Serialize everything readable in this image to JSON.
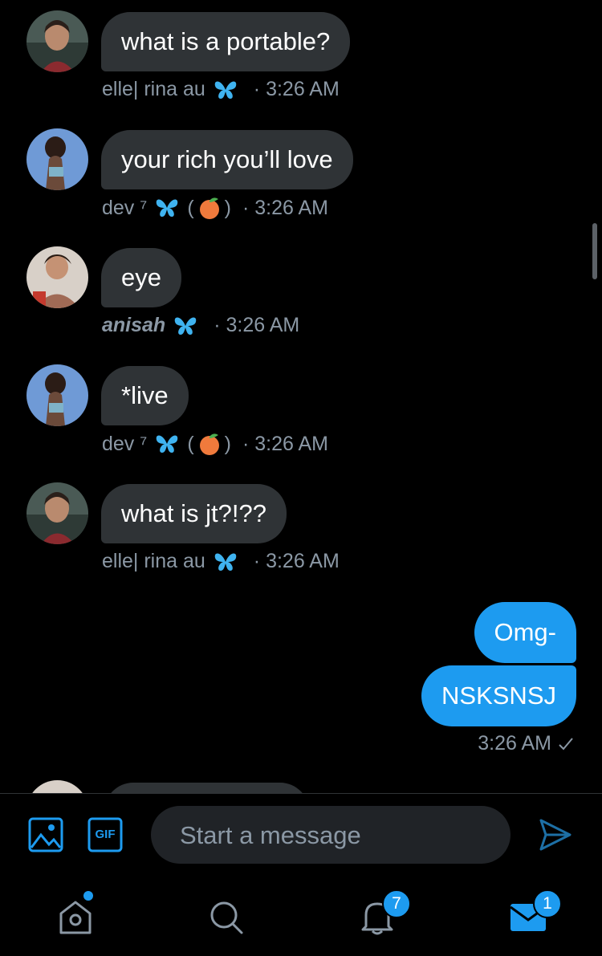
{
  "messages": [
    {
      "text": "what is a portable?",
      "author": "elle| rina au",
      "time": "· 3:26 AM"
    },
    {
      "text": "your rich you’ll love",
      "author": "dev ⁷",
      "time": "· 3:26 AM"
    },
    {
      "text": "eye",
      "author": "anisah",
      "time": "· 3:26 AM"
    },
    {
      "text": "*live",
      "author": "dev ⁷",
      "time": "· 3:26 AM"
    },
    {
      "text": "what is jt?!??",
      "author": "elle| rina au",
      "time": "· 3:26 AM"
    }
  ],
  "outgoing": {
    "messages": [
      "Omg-",
      "NSKSNSJ"
    ],
    "time": "3:26 AM"
  },
  "composer": {
    "placeholder": "Start a message",
    "gif_label": "GIF"
  },
  "tabs": {
    "notifications_badge": "7",
    "messages_badge": "1"
  },
  "colors": {
    "accent": "#1d9bf0",
    "incoming_bubble": "#2f3336",
    "meta_text": "#8b98a5",
    "background": "#000000"
  },
  "icons": [
    "image-icon",
    "gif-icon",
    "send-icon",
    "home-icon",
    "search-icon",
    "bell-icon",
    "mail-icon",
    "butterfly-icon",
    "peach-icon",
    "check-icon"
  ]
}
